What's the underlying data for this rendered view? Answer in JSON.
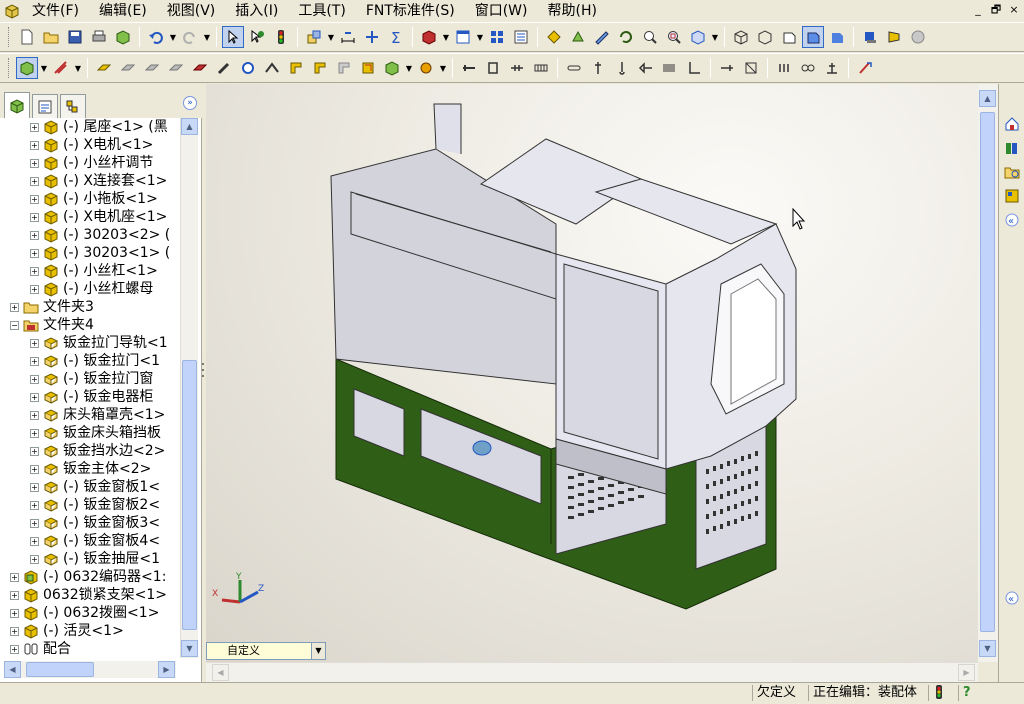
{
  "menubar": {
    "items": [
      "文件(F)",
      "编辑(E)",
      "视图(V)",
      "插入(I)",
      "工具(T)",
      "FNT标准件(S)",
      "窗口(W)",
      "帮助(H)"
    ]
  },
  "window_controls": [
    "_",
    "🗗",
    "×"
  ],
  "tree": {
    "rows": [
      {
        "label": "(-) 尾座<1> (黑",
        "indent": 1,
        "icon": "part-icon"
      },
      {
        "label": "(-) X电机<1>",
        "indent": 1,
        "icon": "part-icon"
      },
      {
        "label": "(-) 小丝杆调节",
        "indent": 1,
        "icon": "part-icon"
      },
      {
        "label": "(-) X连接套<1>",
        "indent": 1,
        "icon": "part-icon"
      },
      {
        "label": "(-) 小拖板<1>",
        "indent": 1,
        "icon": "part-icon"
      },
      {
        "label": "(-) X电机座<1>",
        "indent": 1,
        "icon": "part-icon"
      },
      {
        "label": "(-) 30203<2> (",
        "indent": 1,
        "icon": "part-icon"
      },
      {
        "label": "(-) 30203<1> (",
        "indent": 1,
        "icon": "part-icon"
      },
      {
        "label": "(-) 小丝杠<1>",
        "indent": 1,
        "icon": "part-icon"
      },
      {
        "label": "(-) 小丝杠螺母",
        "indent": 1,
        "icon": "part-icon"
      },
      {
        "label": "文件夹3",
        "indent": 0,
        "icon": "folder-icon"
      },
      {
        "label": "文件夹4",
        "indent": 0,
        "icon": "folder-open-icon",
        "expanded": true
      },
      {
        "label": "钣金拉门导轨<1",
        "indent": 1,
        "icon": "sheetmetal-icon"
      },
      {
        "label": "(-) 钣金拉门<1",
        "indent": 1,
        "icon": "sheetmetal-icon"
      },
      {
        "label": "(-) 钣金拉门窗",
        "indent": 1,
        "icon": "sheetmetal-icon"
      },
      {
        "label": "(-) 钣金电器柜",
        "indent": 1,
        "icon": "sheetmetal-icon"
      },
      {
        "label": "床头箱罩壳<1>",
        "indent": 1,
        "icon": "sheetmetal-icon"
      },
      {
        "label": "钣金床头箱挡板",
        "indent": 1,
        "icon": "sheetmetal-icon"
      },
      {
        "label": "钣金挡水边<2>",
        "indent": 1,
        "icon": "sheetmetal-icon"
      },
      {
        "label": "钣金主体<2>",
        "indent": 1,
        "icon": "sheetmetal-icon"
      },
      {
        "label": "(-) 钣金窗板1<",
        "indent": 1,
        "icon": "sheetmetal-icon"
      },
      {
        "label": "(-) 钣金窗板2<",
        "indent": 1,
        "icon": "sheetmetal-icon"
      },
      {
        "label": "(-) 钣金窗板3<",
        "indent": 1,
        "icon": "sheetmetal-icon"
      },
      {
        "label": "(-) 钣金窗板4<",
        "indent": 1,
        "icon": "sheetmetal-icon"
      },
      {
        "label": "(-) 钣金抽屉<1",
        "indent": 1,
        "icon": "sheetmetal-icon"
      },
      {
        "label": "(-) 0632编码器<1:",
        "indent": 0,
        "icon": "assembly-icon"
      },
      {
        "label": "0632锁紧支架<1>",
        "indent": 0,
        "icon": "part-icon"
      },
      {
        "label": "(-) 0632拨圈<1>",
        "indent": 0,
        "icon": "part-icon"
      },
      {
        "label": "(-) 活灵<1>",
        "indent": 0,
        "icon": "part-icon"
      },
      {
        "label": "配合",
        "indent": 0,
        "icon": "mates-icon"
      }
    ]
  },
  "config": {
    "value": "自定义"
  },
  "status": {
    "custom": "欠定义",
    "editing": "正在编辑：装配体",
    "help": "?"
  },
  "triad": {
    "x": "X",
    "y": "Y",
    "z": "Z"
  },
  "colors": {
    "machine_base": "#2f5e16",
    "machine_cover": "#d8d8e2",
    "tree_part": "#e8c000"
  }
}
